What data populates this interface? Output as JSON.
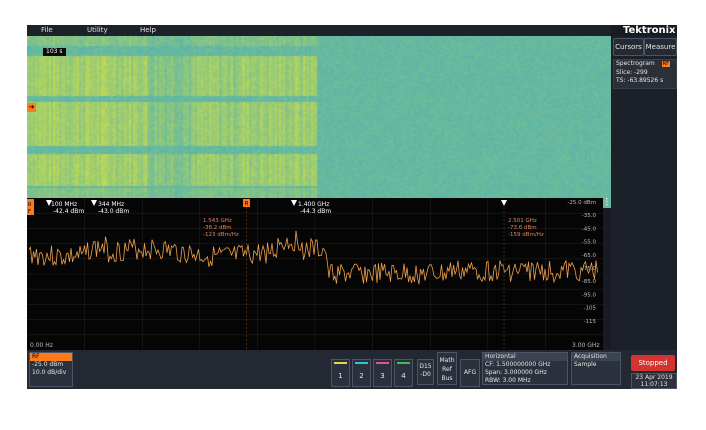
{
  "menu": {
    "file": "File",
    "utility": "Utility",
    "help": "Help"
  },
  "brand": "Tektronix",
  "spectrogram": {
    "time_label": "103 s"
  },
  "right_panel": {
    "cursors_label": "Cursors",
    "measure_label": "Measure",
    "badge_title": "Spectrogram",
    "badge_rf": "RF",
    "slice": "Slice: -299",
    "ts": "TS:   -63.89526 s"
  },
  "markers": [
    {
      "freq": "100 MHz",
      "amp": "-42.4 dBm"
    },
    {
      "freq": "344 MHz",
      "amp": "-43.0 dBm"
    },
    {
      "freq": "1.400 GHz",
      "amp": "-44.3 dBm"
    }
  ],
  "ref_marker": {
    "freq": "1.543 GHz",
    "amp": "-38.2 dBm",
    "density": "-123 dBm/Hz"
  },
  "delta_marker": {
    "freq": "2.501 GHz",
    "amp": "-73.6 dBm",
    "density": "-159 dBm/Hz"
  },
  "spectrum": {
    "y_ticks": [
      "-25.0 dBm",
      "-35.0",
      "-45.0",
      "-55.0",
      "-65.0",
      "-75.0",
      "-85.0",
      "-95.0",
      "-105",
      "-115"
    ],
    "x_start": "0.00 Hz",
    "x_end": "3.00 GHz"
  },
  "rf_badge": {
    "title": "RF",
    "ref_level": "-25.0 dBm",
    "scale": "10.0 dB/div"
  },
  "channels": [
    {
      "label": "1",
      "color": "#e8d44d"
    },
    {
      "label": "2",
      "color": "#2fc7d6"
    },
    {
      "label": "3",
      "color": "#e0509e"
    },
    {
      "label": "4",
      "color": "#3fbf4f"
    }
  ],
  "d15": {
    "line1": "D15",
    "line2": "-D0"
  },
  "math": {
    "line1": "Math",
    "line2": "Ref",
    "line3": "Bus"
  },
  "afg": "AFG",
  "horizontal": {
    "title": "Horizontal",
    "cf": "CF:   1.500000000 GHz",
    "span": "Span: 3.000000 GHz",
    "rbw": "RBW: 3.00 MHz"
  },
  "acquisition": {
    "title": "Acquisition",
    "mode": "Sample"
  },
  "run_state": "Stopped",
  "date": "23 Apr 2019",
  "time": "11:07:13",
  "colors": {
    "trace": "#f0a04b",
    "accent": "#ff7a1a",
    "stopped": "#d4332f"
  }
}
